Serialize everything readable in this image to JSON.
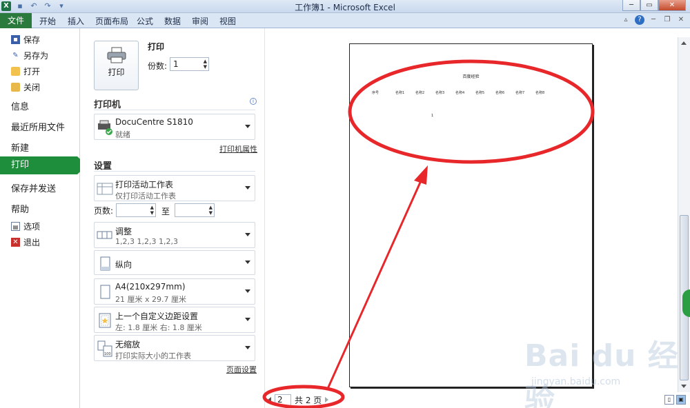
{
  "window": {
    "title": "工作簿1 - Microsoft Excel",
    "app_icon": "X",
    "controls": [
      "─",
      "▭",
      "✕"
    ]
  },
  "ribbon": {
    "file_tab": "文件",
    "tabs": [
      "开始",
      "插入",
      "页面布局",
      "公式",
      "数据",
      "审阅",
      "视图"
    ]
  },
  "nav": {
    "save": "保存",
    "save_as": "另存为",
    "open": "打开",
    "close": "关闭",
    "info": "信息",
    "recent": "最近所用文件",
    "new": "新建",
    "print": "打印",
    "save_send": "保存并发送",
    "help": "帮助",
    "options": "选项",
    "exit": "退出"
  },
  "print_panel": {
    "heading": "打印",
    "print_button": "打印",
    "copies_label": "份数:",
    "copies_value": "1",
    "printer_heading": "打印机",
    "printer_name": "DocuCentre S1810",
    "printer_status": "就绪",
    "printer_properties": "打印机属性",
    "settings_heading": "设置",
    "scope_main": "打印活动工作表",
    "scope_sub": "仅打印活动工作表",
    "pages_label": "页数:",
    "pages_to": "至",
    "collate_main": "调整",
    "collate_sub": "1,2,3    1,2,3    1,2,3",
    "orientation": "纵向",
    "paper_main": "A4(210x297mm)",
    "paper_sub": "21 厘米 x 29.7 厘米",
    "margins_main": "上一个自定义边距设置",
    "margins_sub": "左:  1.8 厘米    右:  1.8 厘米",
    "scaling_main": "无缩放",
    "scaling_sub": "打印实际大小的工作表",
    "page_setup": "页面设置"
  },
  "preview": {
    "page_title": "百度经验",
    "columns": [
      "序号",
      "名称1",
      "名称2",
      "名称3",
      "名称4",
      "名称5",
      "名称6",
      "名称7",
      "名称8"
    ],
    "cell_value": "1",
    "current_page": "2",
    "total_pages": "共 2 页"
  },
  "watermark": {
    "brand": "Bai du 经验",
    "url": "jingyan.baidu.com"
  },
  "colors": {
    "accent_green": "#1e8d3c",
    "annotation_red": "#e8272b"
  }
}
